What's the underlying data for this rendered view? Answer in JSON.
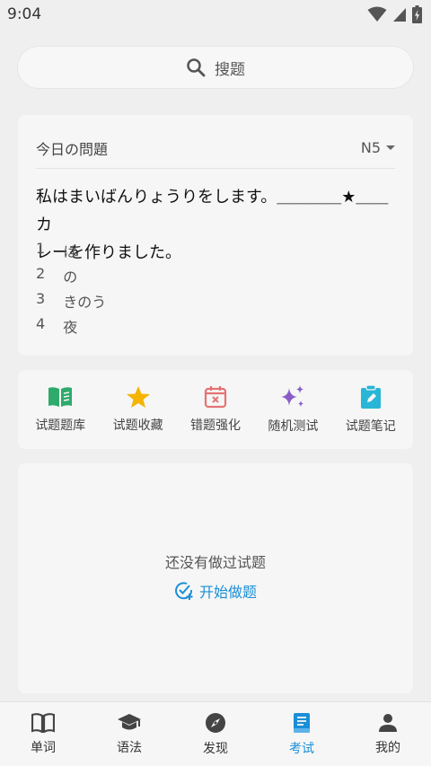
{
  "status": {
    "time": "9:04"
  },
  "search": {
    "placeholder": "搜题"
  },
  "question_card": {
    "title": "今日の問題",
    "level": "N5",
    "question_line1": "私はまいばんりょうりをします。＿＿＿＿★＿＿カ",
    "question_line2": "レーを作りました。",
    "options": [
      {
        "num": "1",
        "text": "は"
      },
      {
        "num": "2",
        "text": "の"
      },
      {
        "num": "3",
        "text": "きのう"
      },
      {
        "num": "4",
        "text": "夜"
      }
    ]
  },
  "functions": [
    {
      "label": "试题题库",
      "icon": "book-open-icon",
      "color": "#2eaa6b"
    },
    {
      "label": "试题收藏",
      "icon": "star-icon",
      "color": "#f4b400"
    },
    {
      "label": "错题强化",
      "icon": "calendar-x-icon",
      "color": "#e57373"
    },
    {
      "label": "随机测试",
      "icon": "sparkle-icon",
      "color": "#8a5cc8"
    },
    {
      "label": "试题笔记",
      "icon": "clipboard-edit-icon",
      "color": "#29b6d6"
    }
  ],
  "empty_state": {
    "message": "还没有做过试题",
    "start_label": "开始做题"
  },
  "tabs": [
    {
      "label": "单词",
      "icon": "book-icon",
      "active": false
    },
    {
      "label": "语法",
      "icon": "graduation-cap-icon",
      "active": false
    },
    {
      "label": "发现",
      "icon": "compass-icon",
      "active": false
    },
    {
      "label": "考试",
      "icon": "exam-book-icon",
      "active": true
    },
    {
      "label": "我的",
      "icon": "person-icon",
      "active": false
    }
  ],
  "colors": {
    "accent": "#1a8fd6",
    "background": "#efefef",
    "card": "#f6f6f6"
  }
}
